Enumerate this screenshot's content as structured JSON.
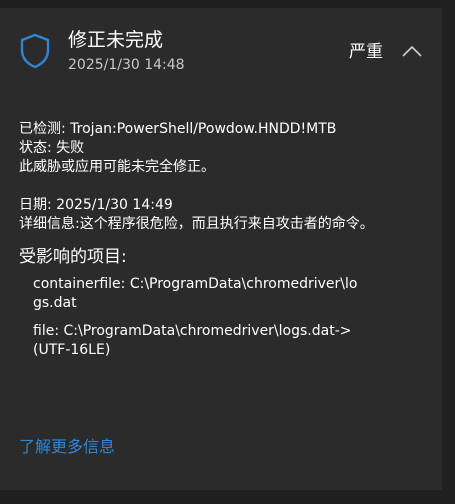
{
  "header": {
    "title": "修正未完成",
    "timestamp": "2025/1/30 14:48",
    "severity": "严重",
    "icons": {
      "status_icon": "shield-icon",
      "collapse_icon": "chevron-up-icon"
    }
  },
  "details": {
    "detected_label": "已检测: ",
    "detected_value": "Trojan:PowerShell/Powdow.HNDD!MTB",
    "status_label": "状态: ",
    "status_value": "失败",
    "note": "此威胁或应用可能未完全修正。",
    "date_label": "日期: ",
    "date_value": "2025/1/30 14:49",
    "info_label": "详细信息: ",
    "info_value": "这个程序很危险，而且执行来自攻击者的命令。"
  },
  "affected": {
    "heading": "受影响的项目:",
    "items": [
      "containerfile: C:\\ProgramData\\chromedriver\\logs.dat",
      "file: C:\\ProgramData\\chromedriver\\logs.dat->(UTF-16LE)"
    ]
  },
  "learn_more_label": "了解更多信息",
  "colors": {
    "accent": "#2f86d6",
    "background": "#2b2b2b"
  }
}
